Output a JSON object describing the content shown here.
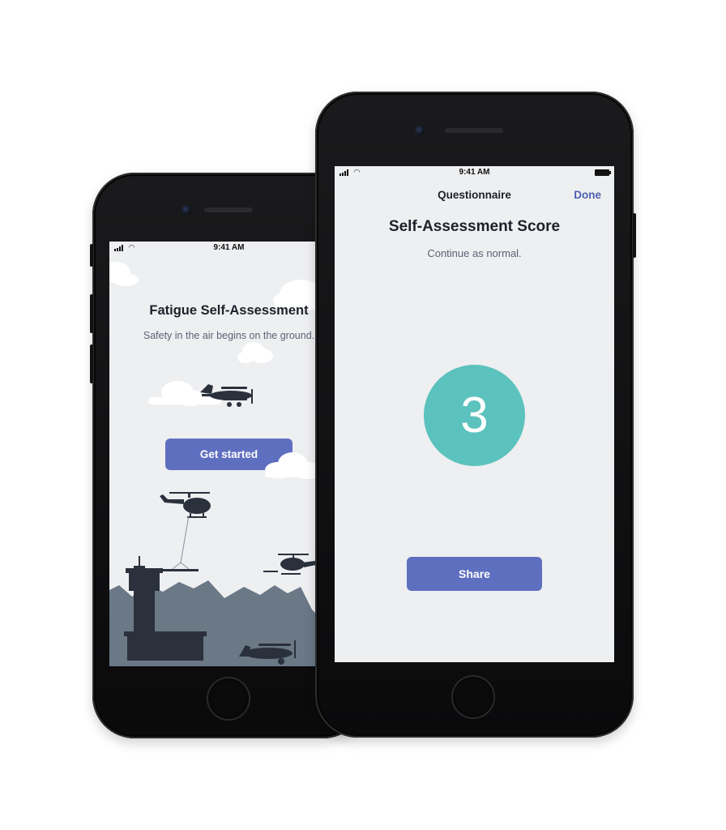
{
  "status_bar": {
    "time": "9:41 AM"
  },
  "welcome_screen": {
    "title": "Fatigue Self-Assessment",
    "subtitle": "Safety in the air begins on the ground.",
    "get_started_label": "Get started"
  },
  "score_screen": {
    "nav_title": "Questionnaire",
    "done_label": "Done",
    "title": "Self-Assessment Score",
    "message": "Continue as normal.",
    "score": "3",
    "share_label": "Share"
  },
  "colors": {
    "accent": "#5f6fc0",
    "score": "#5cc2bd",
    "screen_bg": "#eeeff1",
    "silhouette": "#2b313c",
    "mountains": "#6b7886",
    "done_link": "#4d5fae"
  }
}
